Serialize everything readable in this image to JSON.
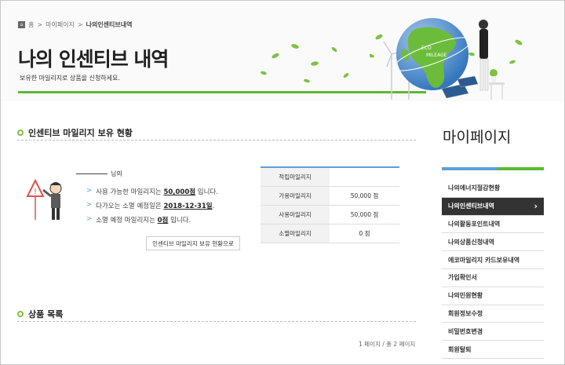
{
  "breadcrumb": {
    "home": "홈",
    "mypage": "마이페이지",
    "current": "나의인센티브내역",
    "sep": ">"
  },
  "header": {
    "title": "나의 인센티브 내역",
    "subtitle": "보유한 마일리지로 상품을 신청하세요.",
    "eco_line1": "ECO",
    "eco_line2": "MILEAGE"
  },
  "status_section": {
    "title": "인센티브 마일리지 보유 현황",
    "name_suffix": "님의",
    "lines": [
      {
        "pre": "사용 가능한 마일리지는 ",
        "val": "50,000점",
        "post": " 입니다."
      },
      {
        "pre": "다가오는 소멸 예정일은 ",
        "val": "2018-12-31일",
        "post": "."
      },
      {
        "pre": "소멸 예정 마일리지는 ",
        "val": "0점",
        "post": " 입니다."
      }
    ],
    "button": "인센티브 마일리지 보유 현황으로"
  },
  "mileage_table": [
    {
      "label": "적립마일리지",
      "value": ""
    },
    {
      "label": "가용마일리지",
      "value": "50,000 점"
    },
    {
      "label": "사용마일리지",
      "value": "50,000 점"
    },
    {
      "label": "소멸마일리지",
      "value": "0 점"
    }
  ],
  "products_section": {
    "title": "상품 목록",
    "pager": "1 페이지 / 총 2 페이지"
  },
  "sidebar": {
    "title": "마이페이지",
    "items": [
      {
        "label": "나의에너지절감현황",
        "active": false
      },
      {
        "label": "나의인센티브내역",
        "active": true
      },
      {
        "label": "나의활동포인트내역",
        "active": false
      },
      {
        "label": "나의상품신청내역",
        "active": false
      },
      {
        "label": "에코마일리지 카드보유내역",
        "active": false
      },
      {
        "label": "가입확인서",
        "active": false
      },
      {
        "label": "나의민원현황",
        "active": false
      },
      {
        "label": "회원정보수정",
        "active": false
      },
      {
        "label": "비밀번호변경",
        "active": false
      },
      {
        "label": "회원탈퇴",
        "active": false
      }
    ]
  },
  "colors": {
    "green": "#5bb832",
    "blue": "#5aa0d8",
    "dark": "#333333"
  }
}
